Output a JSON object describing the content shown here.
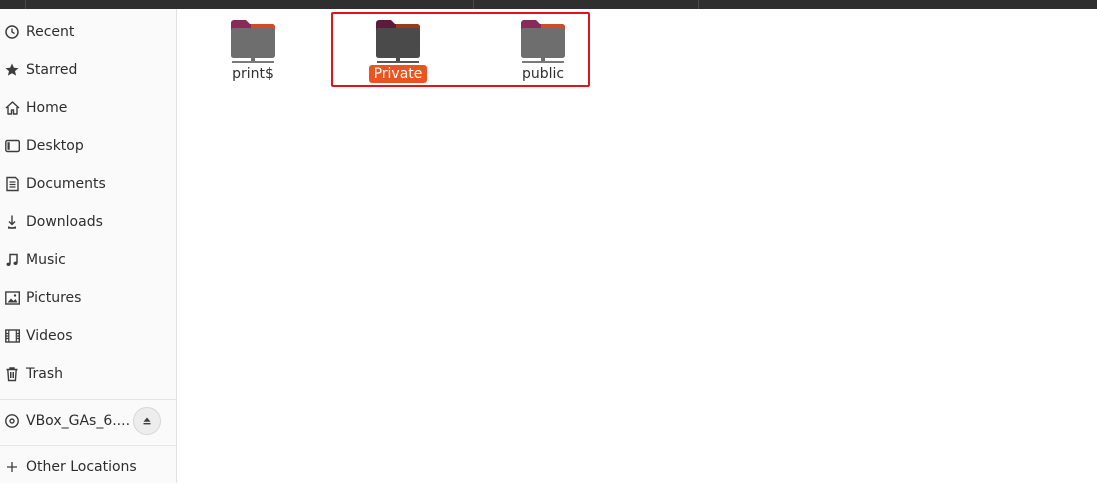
{
  "sidebar": {
    "items": [
      {
        "label": "Recent",
        "icon": "clock-icon"
      },
      {
        "label": "Starred",
        "icon": "star-icon"
      },
      {
        "label": "Home",
        "icon": "home-icon"
      },
      {
        "label": "Desktop",
        "icon": "desktop-icon"
      },
      {
        "label": "Documents",
        "icon": "document-icon"
      },
      {
        "label": "Downloads",
        "icon": "download-icon"
      },
      {
        "label": "Music",
        "icon": "music-icon"
      },
      {
        "label": "Pictures",
        "icon": "picture-icon"
      },
      {
        "label": "Videos",
        "icon": "film-icon"
      },
      {
        "label": "Trash",
        "icon": "trash-icon"
      }
    ],
    "devices": [
      {
        "label": "VBox_GAs_6....",
        "icon": "disc-icon",
        "action_icon": "eject-icon"
      }
    ],
    "other_locations": {
      "label": "Other Locations",
      "icon": "plus-icon"
    }
  },
  "main": {
    "files": [
      {
        "name": "print$",
        "icon": "network-folder-icon",
        "selected": false
      },
      {
        "name": "Private",
        "icon": "network-folder-icon",
        "selected": true
      },
      {
        "name": "public",
        "icon": "network-folder-icon",
        "selected": false
      }
    ],
    "highlight_color": "#e0141e",
    "selection_color": "#e95420"
  }
}
